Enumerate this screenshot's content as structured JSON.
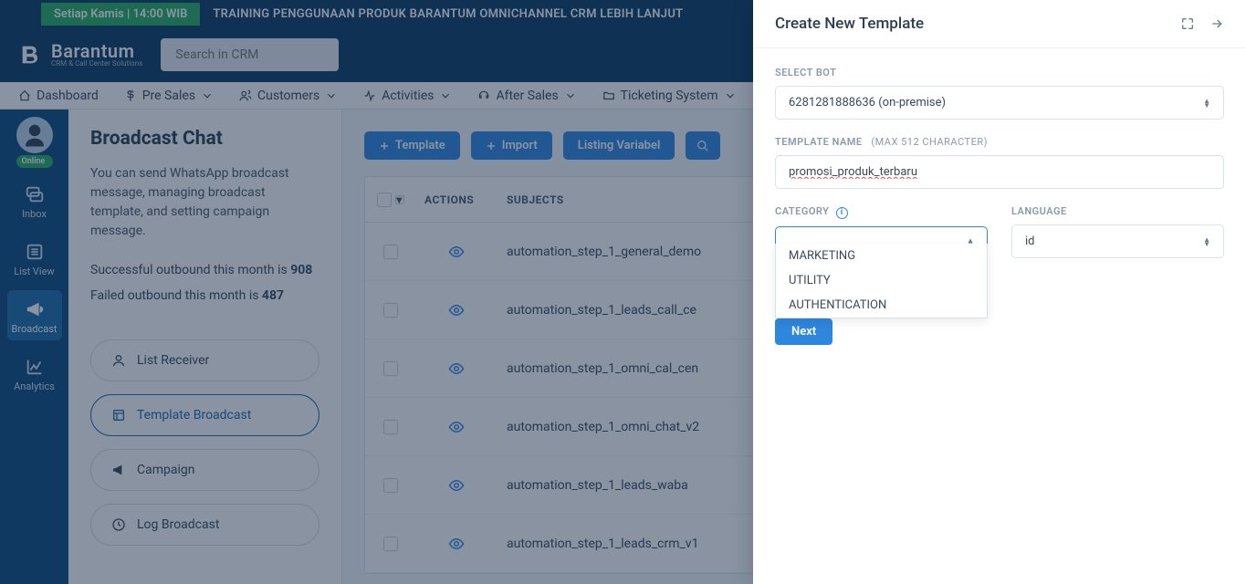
{
  "banner": {
    "badge": "Setiap Kamis | 14:00 WIB",
    "text": "TRAINING PENGGUNAAN PRODUK BARANTUM OMNICHANNEL CRM LEBIH LANJUT"
  },
  "logo": {
    "title": "Barantum",
    "subtitle": "CRM & Call Center Solutions"
  },
  "search": {
    "placeholder": "Search in CRM"
  },
  "nav": {
    "dashboard": "Dashboard",
    "presales": "Pre Sales",
    "customers": "Customers",
    "activities": "Activities",
    "aftersales": "After Sales",
    "ticketing": "Ticketing System"
  },
  "sidebar": {
    "online": "Online",
    "inbox": "Inbox",
    "listview": "List View",
    "broadcast": "Broadcast",
    "analytics": "Analytics"
  },
  "panel": {
    "title": "Broadcast Chat",
    "desc": "You can send WhatsApp broadcast message, managing broadcast template, and setting campaign message.",
    "stat1_prefix": "Successful outbound this month is ",
    "stat1_value": "908",
    "stat2_prefix": "Failed outbound this month is ",
    "stat2_value": "487",
    "sub": {
      "receiver": "List Receiver",
      "template": "Template Broadcast",
      "campaign": "Campaign",
      "log": "Log Broadcast"
    }
  },
  "toolbar": {
    "template": "Template",
    "import": "Import",
    "listing": "Listing Variabel"
  },
  "table": {
    "header": {
      "actions": "ACTIONS",
      "subjects": "SUBJECTS"
    },
    "rows": [
      "automation_step_1_general_demo",
      "automation_step_1_leads_call_ce",
      "automation_step_1_omni_cal_cen",
      "automation_step_1_omni_chat_v2",
      "automation_step_1_leads_waba",
      "automation_step_1_leads_crm_v1"
    ]
  },
  "modal": {
    "title": "Create New Template",
    "labels": {
      "selectbot": "SELECT BOT",
      "templatename": "TEMPLATE NAME",
      "templatehint": "(MAX 512 CHARACTER)",
      "category": "CATEGORY",
      "language": "LANGUAGE"
    },
    "bot": "6281281888636 (on-premise)",
    "templatename_value": "promosi_produk_terbaru",
    "language_value": "id",
    "options": {
      "marketing": "MARKETING",
      "utility": "UTILITY",
      "authentication": "AUTHENTICATION"
    },
    "next": "Next"
  }
}
